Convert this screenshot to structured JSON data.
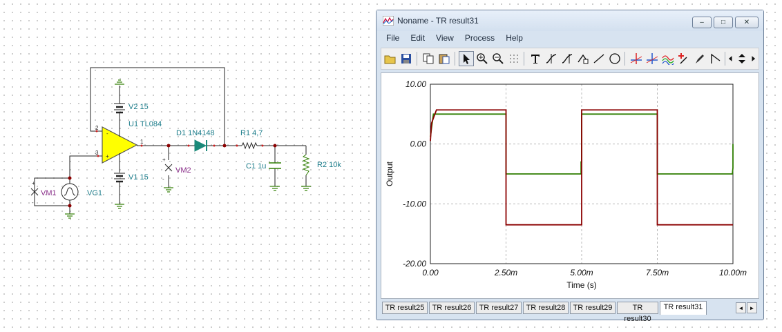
{
  "schematic": {
    "labels": {
      "v2": "V2 15",
      "u1": "U1 TL084",
      "v1": "V1 15",
      "d1": "D1 1N4148",
      "r1": "R1 4,7",
      "c1": "C1 1u",
      "r2": "R2 10k",
      "vm1": "VM1",
      "vm2": "VM2",
      "vg1": "VG1"
    },
    "pins": {
      "p1": "1",
      "p2": "2",
      "p3": "3",
      "plus": "+",
      "minus": "-"
    }
  },
  "window": {
    "title": "Noname - TR result31",
    "controls": {
      "minimize": "–",
      "maximize": "□",
      "close": "✕"
    },
    "menu": [
      "File",
      "Edit",
      "View",
      "Process",
      "Help"
    ]
  },
  "chart_data": {
    "type": "line",
    "title": "",
    "xlabel": "Time (s)",
    "ylabel": "Output",
    "xlim": [
      0,
      0.01
    ],
    "ylim": [
      -20,
      10
    ],
    "x_ticks": [
      "0.00",
      "2.50m",
      "5.00m",
      "7.50m",
      "10.00m"
    ],
    "y_ticks": [
      "10.00",
      "0.00",
      "-10.00",
      "-20.00"
    ],
    "grid": true,
    "series": [
      {
        "color": "#8b0000",
        "x": [
          0,
          4e-05,
          0.0002,
          0.0025,
          0.0025,
          0.005,
          0.005,
          0.0075,
          0.0075,
          0.01
        ],
        "y": [
          0.5,
          3.5,
          5.7,
          5.7,
          -13.5,
          -13.5,
          5.7,
          5.7,
          -13.5,
          -13.5
        ]
      },
      {
        "color": "#2e7d00",
        "x": [
          0,
          0.0001,
          0.0025,
          0.0025,
          0.00498,
          0.00498,
          0.005,
          0.005,
          0.0075,
          0.0075,
          0.00998,
          0.01,
          0.01
        ],
        "y": [
          1.2,
          5.0,
          5.0,
          -5.0,
          -5.0,
          -3.0,
          -3.0,
          5.0,
          5.0,
          -5.0,
          -5.0,
          -4.0,
          0.0
        ]
      }
    ]
  },
  "tabs": [
    {
      "label": "TR result25"
    },
    {
      "label": "TR result26"
    },
    {
      "label": "TR result27"
    },
    {
      "label": "TR result28"
    },
    {
      "label": "TR result29"
    },
    {
      "label": "TR result30"
    },
    {
      "label": "TR result31",
      "active": true
    }
  ],
  "tab_scroll": {
    "left": "◄",
    "right": "►"
  },
  "toolbar_icons": [
    "open-icon",
    "save-icon",
    "copy-icon",
    "paste-icon",
    "pointer-icon",
    "zoom-in-icon",
    "zoom-100-icon",
    "grid-icon",
    "text-icon",
    "cursor-a-icon",
    "cursor-b-icon",
    "axis-icon",
    "line-icon",
    "circle-icon",
    "marker-a-icon",
    "marker-b-icon",
    "curve-icon",
    "probe-icon",
    "pen-icon",
    "step-icon",
    "left-icon",
    "updown-icon",
    "right-icon"
  ]
}
